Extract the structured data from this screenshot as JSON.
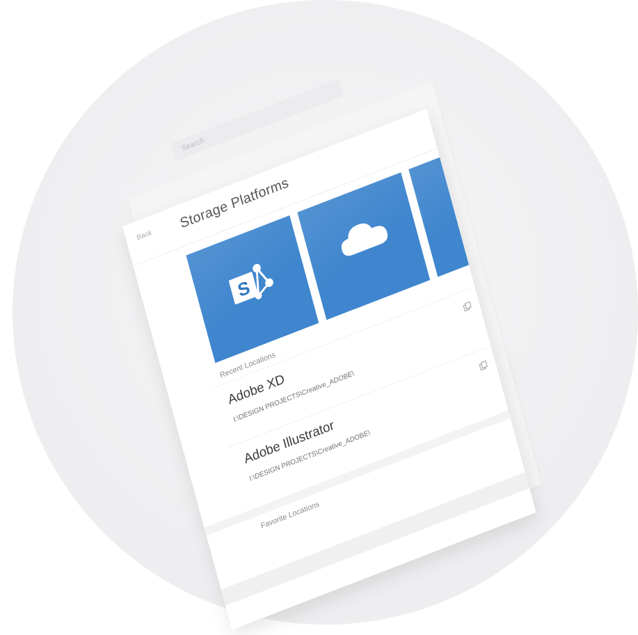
{
  "search": {
    "placeholder": "Search"
  },
  "header": {
    "back_label": "Back",
    "title": "Storage Platforms"
  },
  "platforms": [
    {
      "name": "SharePoint",
      "icon": "sharepoint-icon",
      "color": "#3f86ce"
    },
    {
      "name": "OneDrive",
      "icon": "onedrive-cloud-icon",
      "color": "#3f86ce"
    },
    {
      "name": "",
      "icon": "",
      "color": "#3f86ce"
    }
  ],
  "recent": {
    "label": "Recent Locations",
    "items": [
      {
        "title": "Adobe XD",
        "path": "I:\\DESIGN PROJECTS\\Creative_ADOBE\\",
        "icon": "copy-icon"
      },
      {
        "title": "Adobe Illustrator",
        "path": "I:\\DESIGN PROJECTS\\Creative_ADOBE\\",
        "icon": "copy-icon"
      }
    ]
  },
  "favorites": {
    "label": "Favorite Locations"
  },
  "colors": {
    "accent": "#3f86ce",
    "background": "#efeff1",
    "surface": "#ffffff"
  }
}
